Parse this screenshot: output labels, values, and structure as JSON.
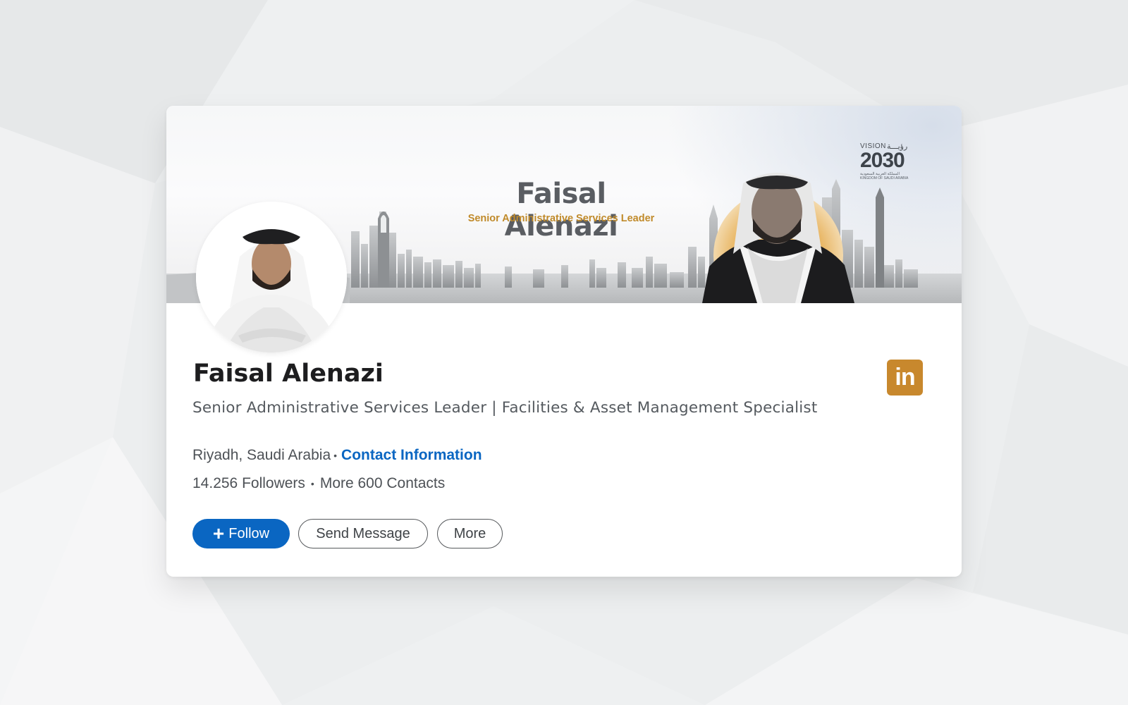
{
  "banner": {
    "title": "Faisal Alenazi",
    "subtitle": "Senior Administrative Services Leader",
    "vision_logo": {
      "top": "VISION",
      "arabic": "رؤيـــة",
      "number": "2030",
      "kingdom_ar": "المملكة العربية السعودية",
      "kingdom_en": "KINGDOM OF SAUDI ARABIA"
    }
  },
  "profile": {
    "name": "Faisal Alenazi",
    "headline": "Senior Administrative Services Leader | Facilities & Asset Management Specialist",
    "location": "Riyadh, Saudi Arabia",
    "location_separator": "•",
    "contact_link": "Contact Information",
    "followers": "14.256 Followers",
    "stats_separator": "•",
    "contacts": "More 600 Contacts"
  },
  "actions": {
    "follow_icon": "+",
    "follow_label": "Follow",
    "message_label": "Send Message",
    "more_label": "More"
  },
  "linkedin_icon": {
    "text": "in",
    "color": "#c8882d"
  },
  "colors": {
    "primary": "#0a66c2",
    "accent_gold": "#c08a2a",
    "background": "#eceeef"
  }
}
